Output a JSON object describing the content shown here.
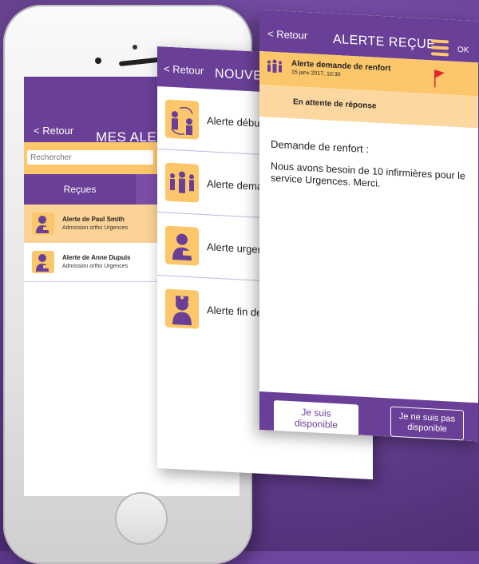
{
  "colors": {
    "purple": "#6a3f97",
    "orange": "#fbc76a",
    "light_orange": "#fcd8a0",
    "flag_red": "#e2282d"
  },
  "screen1": {
    "back_label": "< Retour",
    "title": "MES ALERTES",
    "search_placeholder": "Rechercher",
    "tab_received": "Reçues",
    "items": [
      {
        "title": "Alerte de Paul Smith",
        "subtitle": "Admission ortho Urgences",
        "icon": "patient-icon"
      },
      {
        "title": "Alerte de Anne Dupuis",
        "subtitle": "Admission ortho Urgences",
        "icon": "patient-icon"
      }
    ]
  },
  "screen2": {
    "back_label": "< Retour",
    "title": "NOUVELLE ALERTE",
    "items": [
      {
        "label": "Alerte début",
        "icon": "shift-change-icon"
      },
      {
        "label": "Alerte demande",
        "icon": "staff-group-icon"
      },
      {
        "label": "Alerte urgence",
        "icon": "patient-icon"
      },
      {
        "label": "Alerte fin de",
        "icon": "nurse-icon"
      }
    ]
  },
  "screen3": {
    "back_label": "< Retour",
    "title": "ALERTE REÇUE",
    "ok_label": "OK",
    "alert_title": "Alerte demande de renfort",
    "alert_date": "15 janv 2017, 10:30",
    "status": "En attente de réponse",
    "body_heading": "Demande de renfort :",
    "body_text": "Nous avons besoin de 10 infirmières pour le service Urgences. Merci.",
    "btn_available": "Je suis disponible",
    "btn_unavailable": "Je ne suis pas disponible"
  }
}
